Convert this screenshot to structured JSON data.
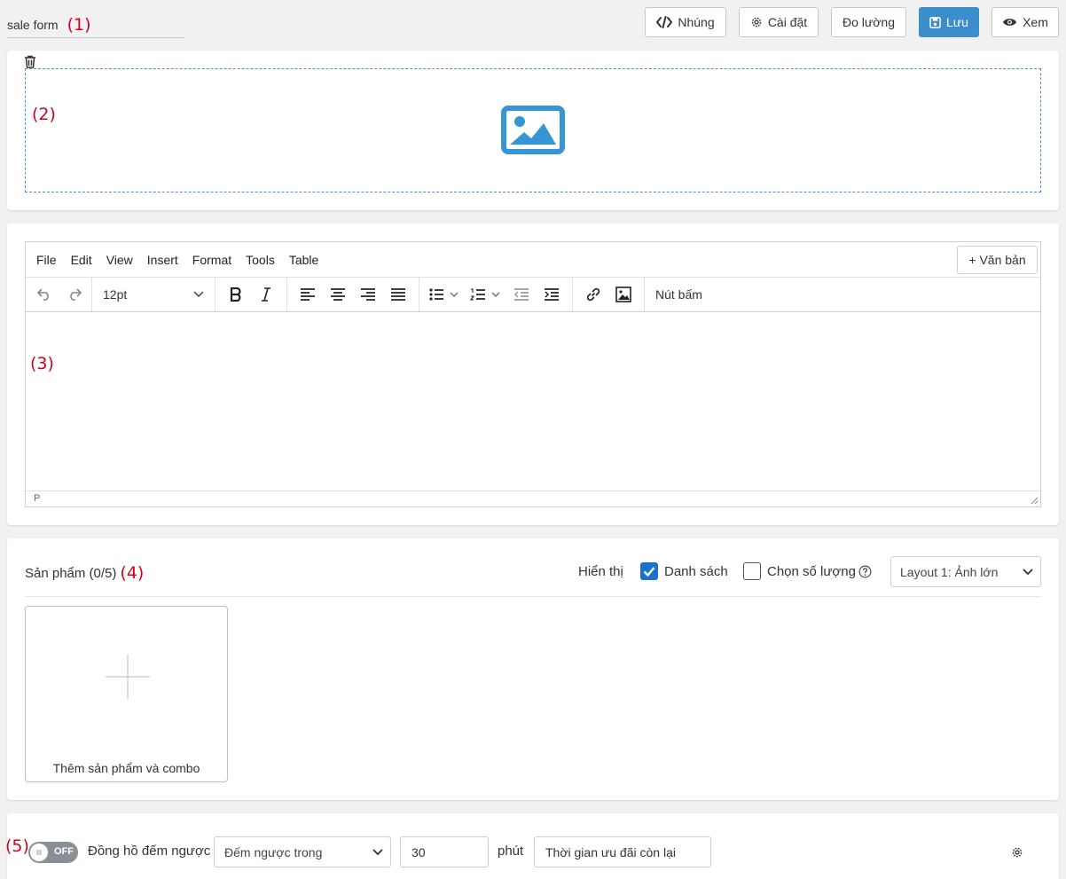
{
  "header": {
    "form_name": "sale form",
    "markers": {
      "m1": "(1)",
      "m2": "(2)",
      "m3": "(3)",
      "m4": "(4)",
      "m5": "(5)"
    },
    "buttons": {
      "embed": "Nhúng",
      "settings": "Cài đặt",
      "measure": "Đo lường",
      "save": "Lưu",
      "preview": "Xem"
    },
    "icons": {
      "embed": "code-icon",
      "settings": "gear-icon",
      "save": "floppy-icon",
      "preview": "eye-icon"
    }
  },
  "image_block": {
    "icons": [
      "trash-icon",
      "image-placeholder-icon"
    ]
  },
  "editor": {
    "menu": [
      "File",
      "Edit",
      "View",
      "Insert",
      "Format",
      "Tools",
      "Table"
    ],
    "add_text": "+ Văn bản",
    "font_size": "12pt",
    "button_label": "Nút bấm",
    "status_path": "P"
  },
  "products": {
    "title": "Sản phẩm (0/5)",
    "show_label": "Hiển thị",
    "list_label": "Danh sách",
    "list_checked": true,
    "qty_label": "Chọn số lượng",
    "qty_checked": false,
    "layout_value": "Layout 1: Ảnh lớn",
    "add_card_label": "Thêm sản phẩm và combo"
  },
  "countdown": {
    "toggle_label": "OFF",
    "label": "Đồng hồ đếm ngược",
    "mode_value": "Đếm ngược trong",
    "duration_value": "30",
    "unit": "phút",
    "message_value": "Thời gian ưu đãi còn lại"
  },
  "colors": {
    "primary": "#3c8dcc",
    "marker": "#d0021b",
    "checkbox": "#1a73c8",
    "toggle_off": "#8a8f96"
  }
}
